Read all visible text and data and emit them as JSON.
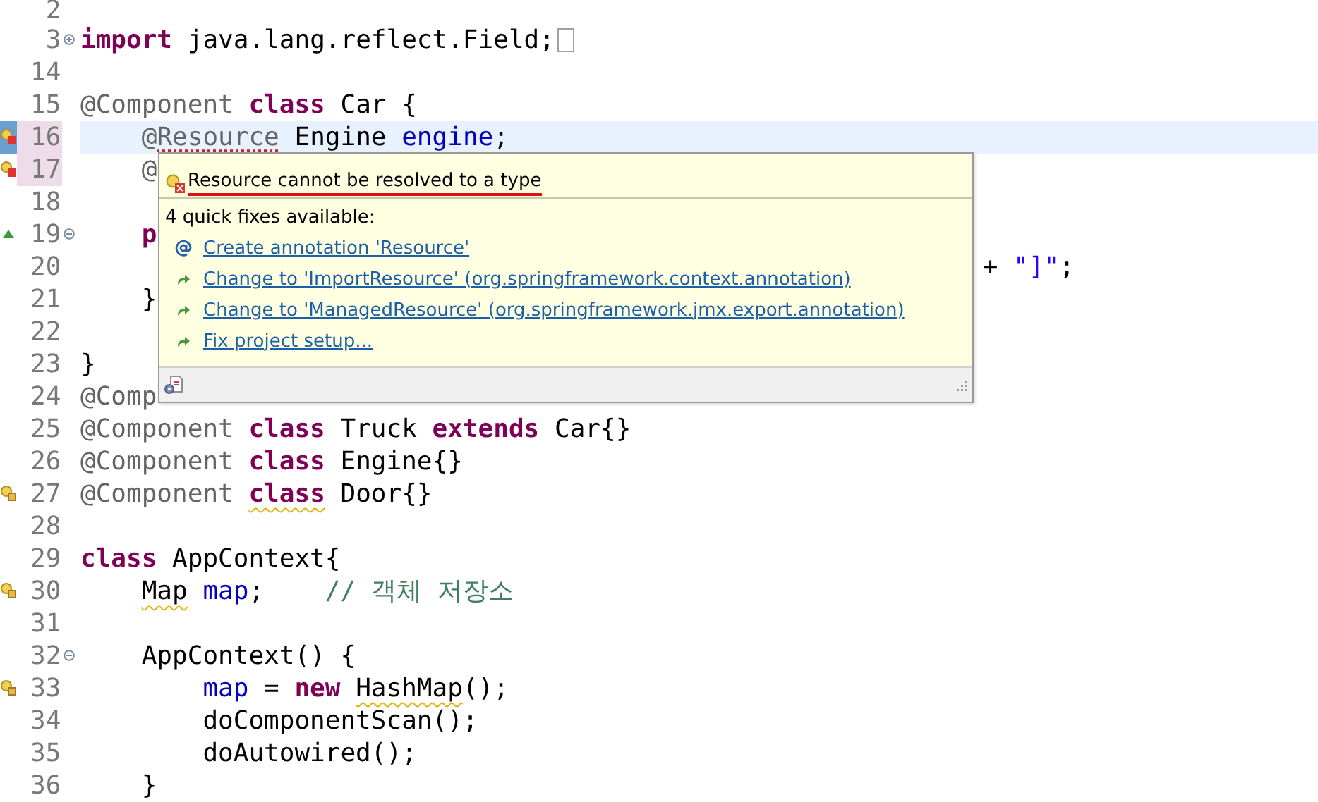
{
  "editor": {
    "lines": [
      {
        "number": "2",
        "current": false,
        "error_line": false
      },
      {
        "number": "3",
        "fold": {
          "kind": "expand"
        },
        "current": false,
        "error_line": false,
        "segments": [
          {
            "kind": "keyword",
            "text": "import"
          },
          {
            "kind": "plain",
            "text": " java.lang.reflect.Field;"
          }
        ],
        "folded_box": true
      },
      {
        "number": "14",
        "current": false,
        "error_line": false
      },
      {
        "number": "15",
        "current": false,
        "error_line": false,
        "segments": [
          {
            "kind": "annotation",
            "text": "@Component"
          },
          {
            "kind": "keyword",
            "text": " class"
          },
          {
            "kind": "plain",
            "text": " Car {"
          }
        ]
      },
      {
        "number": "16",
        "marker": {
          "kind": "error"
        },
        "current": true,
        "error_line": true,
        "indent": {
          "kind": "single"
        },
        "segments": [
          {
            "kind": "annotation",
            "text": "@"
          },
          {
            "kind": "annotation",
            "text": "Resource",
            "squiggle": {
              "kind": "error"
            }
          },
          {
            "kind": "plain",
            "text": " Engine "
          },
          {
            "kind": "field",
            "text": "engine"
          },
          {
            "kind": "plain",
            "text": ";"
          }
        ]
      },
      {
        "number": "17",
        "marker": {
          "kind": "error"
        },
        "current": false,
        "error_line": true,
        "indent": {
          "kind": "single"
        },
        "segments": [
          {
            "kind": "annotation",
            "text": "@"
          }
        ]
      },
      {
        "number": "18",
        "current": false,
        "error_line": false
      },
      {
        "number": "19",
        "marker": {
          "kind": "override"
        },
        "fold": {
          "kind": "collapse"
        },
        "current": false,
        "error_line": false,
        "indent": {
          "kind": "single"
        },
        "segments": [
          {
            "kind": "keyword",
            "text": "p"
          }
        ]
      },
      {
        "number": "20",
        "current": false,
        "error_line": false,
        "indent": {
          "kind": "continuation"
        },
        "segments": [
          {
            "kind": "plain",
            "text": "+ "
          },
          {
            "kind": "string",
            "text": "\"]\""
          },
          {
            "kind": "plain",
            "text": ";"
          }
        ]
      },
      {
        "number": "21",
        "current": false,
        "error_line": false,
        "indent": {
          "kind": "single"
        },
        "segments": [
          {
            "kind": "plain",
            "text": "}"
          }
        ]
      },
      {
        "number": "22",
        "current": false,
        "error_line": false
      },
      {
        "number": "23",
        "current": false,
        "error_line": false,
        "segments": [
          {
            "kind": "plain",
            "text": "}"
          }
        ]
      },
      {
        "number": "24",
        "current": false,
        "error_line": false,
        "segments": [
          {
            "kind": "annotation",
            "text": "@Comp"
          }
        ]
      },
      {
        "number": "25",
        "current": false,
        "error_line": false,
        "segments": [
          {
            "kind": "annotation",
            "text": "@Component"
          },
          {
            "kind": "keyword",
            "text": " class"
          },
          {
            "kind": "plain",
            "text": " Truck"
          },
          {
            "kind": "keyword",
            "text": " extends"
          },
          {
            "kind": "plain",
            "text": " Car{}"
          }
        ]
      },
      {
        "number": "26",
        "current": false,
        "error_line": false,
        "segments": [
          {
            "kind": "annotation",
            "text": "@Component"
          },
          {
            "kind": "keyword",
            "text": " class"
          },
          {
            "kind": "plain",
            "text": " Engine{}"
          }
        ]
      },
      {
        "number": "27",
        "marker": {
          "kind": "warning"
        },
        "current": false,
        "error_line": false,
        "segments": [
          {
            "kind": "annotation",
            "text": "@Component "
          },
          {
            "kind": "keyword",
            "text": "class",
            "squiggle": {
              "kind": "warning"
            }
          },
          {
            "kind": "plain",
            "text": " Door{}"
          }
        ]
      },
      {
        "number": "28",
        "current": false,
        "error_line": false
      },
      {
        "number": "29",
        "current": false,
        "error_line": false,
        "segments": [
          {
            "kind": "keyword",
            "text": "class"
          },
          {
            "kind": "plain",
            "text": " AppContext{"
          }
        ]
      },
      {
        "number": "30",
        "marker": {
          "kind": "warning"
        },
        "current": false,
        "error_line": false,
        "indent": {
          "kind": "single"
        },
        "segments": [
          {
            "kind": "plain",
            "text": "Map",
            "squiggle": {
              "kind": "warning"
            }
          },
          {
            "kind": "field",
            "text": " map"
          },
          {
            "kind": "plain",
            "text": ";"
          },
          {
            "kind": "comment",
            "text": "    // 객체 저장소"
          }
        ]
      },
      {
        "number": "31",
        "current": false,
        "error_line": false
      },
      {
        "number": "32",
        "fold": {
          "kind": "collapse"
        },
        "current": false,
        "error_line": false,
        "indent": {
          "kind": "single"
        },
        "segments": [
          {
            "kind": "plain",
            "text": "AppContext() {"
          }
        ]
      },
      {
        "number": "33",
        "marker": {
          "kind": "warning"
        },
        "current": false,
        "error_line": false,
        "indent": {
          "kind": "double"
        },
        "segments": [
          {
            "kind": "field",
            "text": "map"
          },
          {
            "kind": "plain",
            "text": " = "
          },
          {
            "kind": "keyword",
            "text": "new "
          },
          {
            "kind": "plain",
            "text": "HashMap",
            "squiggle": {
              "kind": "warning"
            }
          },
          {
            "kind": "plain",
            "text": "();"
          }
        ]
      },
      {
        "number": "34",
        "current": false,
        "error_line": false,
        "indent": {
          "kind": "double"
        },
        "segments": [
          {
            "kind": "plain",
            "text": "doComponentScan();"
          }
        ]
      },
      {
        "number": "35",
        "current": false,
        "error_line": false,
        "indent": {
          "kind": "double"
        },
        "segments": [
          {
            "kind": "plain",
            "text": "doAutowired();"
          }
        ]
      },
      {
        "number": "36",
        "current": false,
        "error_line": false,
        "indent": {
          "kind": "single"
        },
        "segments": [
          {
            "kind": "plain",
            "text": "}"
          }
        ]
      }
    ]
  },
  "quick_fix_popup": {
    "title": "Resource cannot be resolved to a type",
    "summary": "4 quick fixes available:",
    "fixes": [
      {
        "kind": "create",
        "label": "Create annotation 'Resource'"
      },
      {
        "kind": "change",
        "label": "Change to 'ImportResource' (org.springframework.context.annotation)"
      },
      {
        "kind": "change",
        "label": "Change to 'ManagedResource' (org.springframework.jmx.export.annotation)"
      },
      {
        "kind": "change",
        "label": "Fix project setup..."
      }
    ]
  }
}
